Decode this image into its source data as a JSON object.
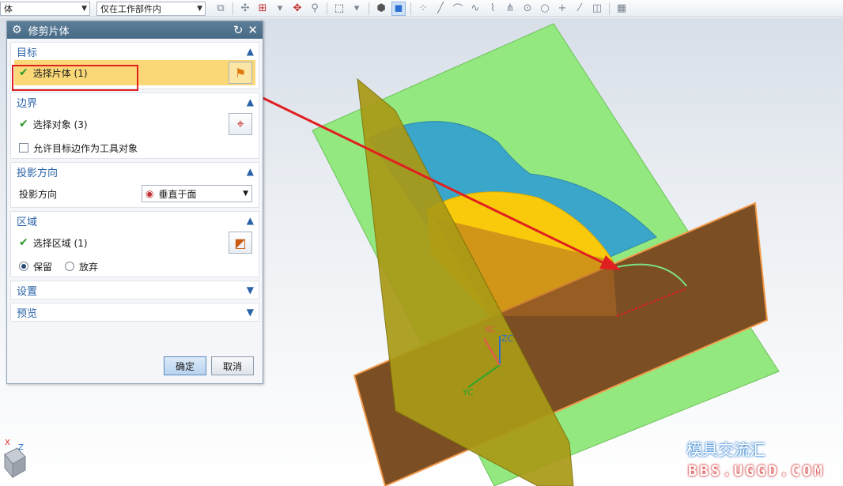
{
  "toolbar": {
    "filter_value": "体",
    "scope_value": "仅在工作部件内"
  },
  "dialog": {
    "title": "修剪片体",
    "sections": {
      "target": {
        "title": "目标",
        "select_label": "选择片体 (1)"
      },
      "boundary": {
        "title": "边界",
        "select_label": "选择对象 (3)",
        "allow_label": "允许目标边作为工具对象"
      },
      "projection": {
        "title": "投影方向",
        "label": "投影方向",
        "value": "垂直于面"
      },
      "region": {
        "title": "区域",
        "select_label": "选择区域 (1)",
        "keep_label": "保留",
        "discard_label": "放弃",
        "selected": "keep"
      },
      "settings": {
        "title": "设置"
      },
      "preview": {
        "title": "预览"
      }
    },
    "ok_label": "确定",
    "cancel_label": "取消"
  },
  "viewport": {
    "axis_zc": "ZC",
    "axis_yc": "YC",
    "axis_xc": "XC",
    "triad_x": "X",
    "triad_z": "Z"
  },
  "watermark": {
    "brand": "模具交流汇",
    "url": "BBS.UGGD.COM"
  },
  "colors": {
    "plane_green": "#93e87f",
    "surface_brown": "#7b4e24",
    "dome_blue": "#3aa6c9",
    "dome_yellow": "#f9c90c",
    "annotation_red": "#e02020"
  }
}
